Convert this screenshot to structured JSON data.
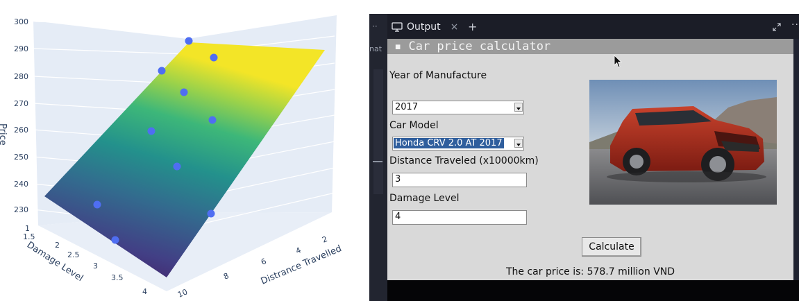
{
  "chart": {
    "z_axis_title": "Price",
    "x_axis_title": "Damage Level",
    "y_axis_title": "Distrance Travelled",
    "z_ticks": [
      "230",
      "240",
      "250",
      "260",
      "270",
      "280",
      "290",
      "300"
    ],
    "x_ticks": [
      "1",
      "1.5",
      "2",
      "2.5",
      "3",
      "3.5",
      "4"
    ],
    "y_ticks": [
      "10",
      "8",
      "6",
      "4",
      "2"
    ]
  },
  "chart_data": {
    "type": "scatter",
    "subtype": "3d-scatter-with-regression-surface",
    "zlabel": "Price",
    "xlabel": "Damage Level",
    "ylabel": "Distrance Travelled",
    "xlim": [
      1,
      4
    ],
    "ylim": [
      2,
      10
    ],
    "zlim": [
      225,
      300
    ],
    "surface_colorscale": "viridis",
    "grid": true,
    "point_color": "#4f6ef2"
  },
  "ide": {
    "left_strip_dots": "··",
    "left_strip_text": "nat",
    "tab_label": "Output",
    "tab_close": "×",
    "tab_add": "+",
    "more": "···"
  },
  "app": {
    "title": "▪ Car price calculator",
    "year_label": "Year of Manufacture",
    "year_value": "2017",
    "model_label": "Car Model",
    "model_value": "Honda CRV 2.0 AT 2017",
    "distance_label": "Distance Traveled (x10000km)",
    "distance_value": "3",
    "damage_label": "Damage Level",
    "damage_value": "4",
    "calc_button": "Calculate",
    "result": "The car price is: 578.7 million VND"
  }
}
